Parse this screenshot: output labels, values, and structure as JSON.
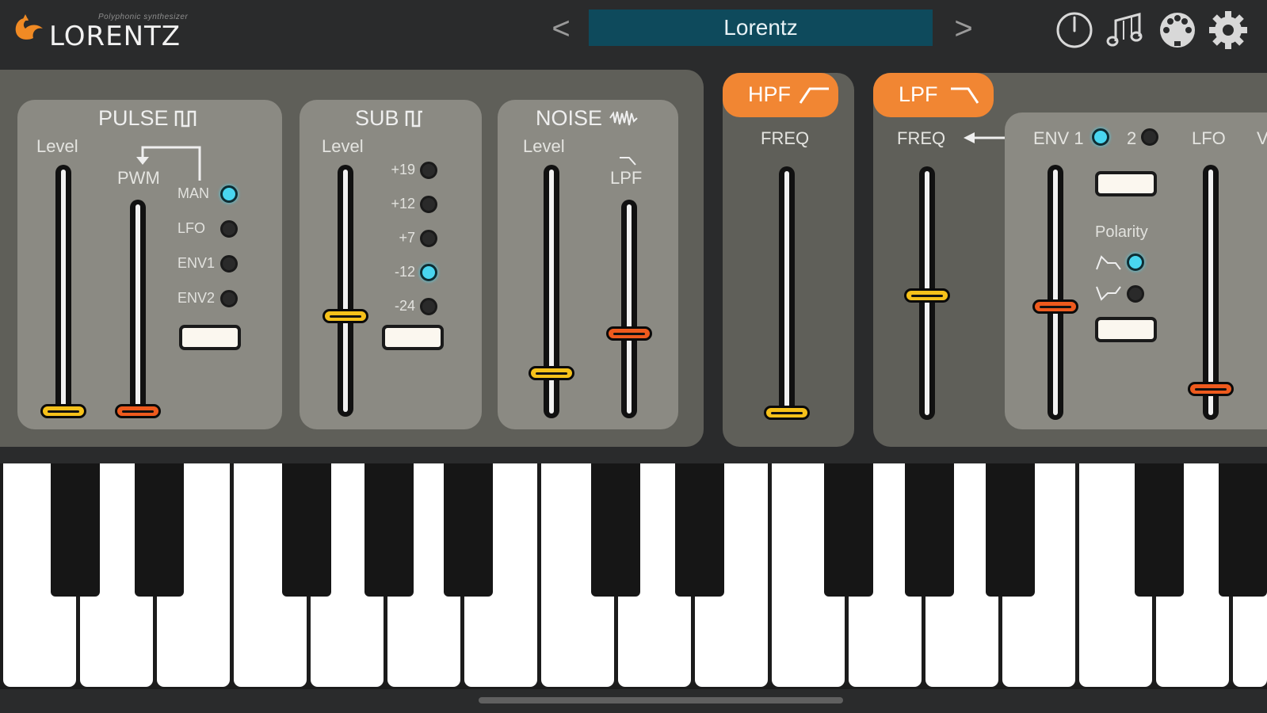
{
  "header": {
    "logo_tagline": "Polyphonic synthesizer",
    "logo_name": "LORENTZ",
    "preset_name": "Lorentz",
    "prev_label": "<",
    "next_label": ">",
    "icons": [
      "power-icon",
      "music-notes-icon",
      "midi-connector-icon",
      "gear-icon"
    ]
  },
  "pulse": {
    "title": "PULSE",
    "level_label": "Level",
    "pwm_label": "PWM",
    "level_value": 0.0,
    "pwm_value": 0.0,
    "sources": [
      {
        "label": "MAN",
        "active": true
      },
      {
        "label": "LFO",
        "active": false
      },
      {
        "label": "ENV1",
        "active": false
      },
      {
        "label": "ENV2",
        "active": false
      }
    ]
  },
  "sub": {
    "title": "SUB",
    "level_label": "Level",
    "level_value": 0.4,
    "intervals": [
      {
        "label": "+19",
        "active": false
      },
      {
        "label": "+12",
        "active": false
      },
      {
        "label": "+7",
        "active": false
      },
      {
        "label": "-12",
        "active": true
      },
      {
        "label": "-24",
        "active": false
      }
    ]
  },
  "noise": {
    "title": "NOISE",
    "level_label": "Level",
    "lpf_label": "LPF",
    "level_value": 0.18,
    "lpf_value": 0.4
  },
  "hpf": {
    "title": "HPF",
    "freq_label": "FREQ",
    "freq_value": 0.02
  },
  "lpf": {
    "title": "LPF",
    "freq_label": "FREQ",
    "freq_value": 0.5,
    "env1_label": "ENV 1",
    "env2_label": "2",
    "env_selected": "ENV 1",
    "env_amount": 0.45,
    "polarity_label": "Polarity",
    "polarity_positive_active": true,
    "polarity_negative_active": false,
    "lfo_label": "LFO",
    "lfo_amount": 0.12
  },
  "colors": {
    "accent_cyan": "#49d6f0",
    "handle_yellow": "#f6c11a",
    "handle_orange": "#ee5a1d",
    "filter_tab": "#f18633",
    "preset_bg": "#0e4a5c"
  }
}
